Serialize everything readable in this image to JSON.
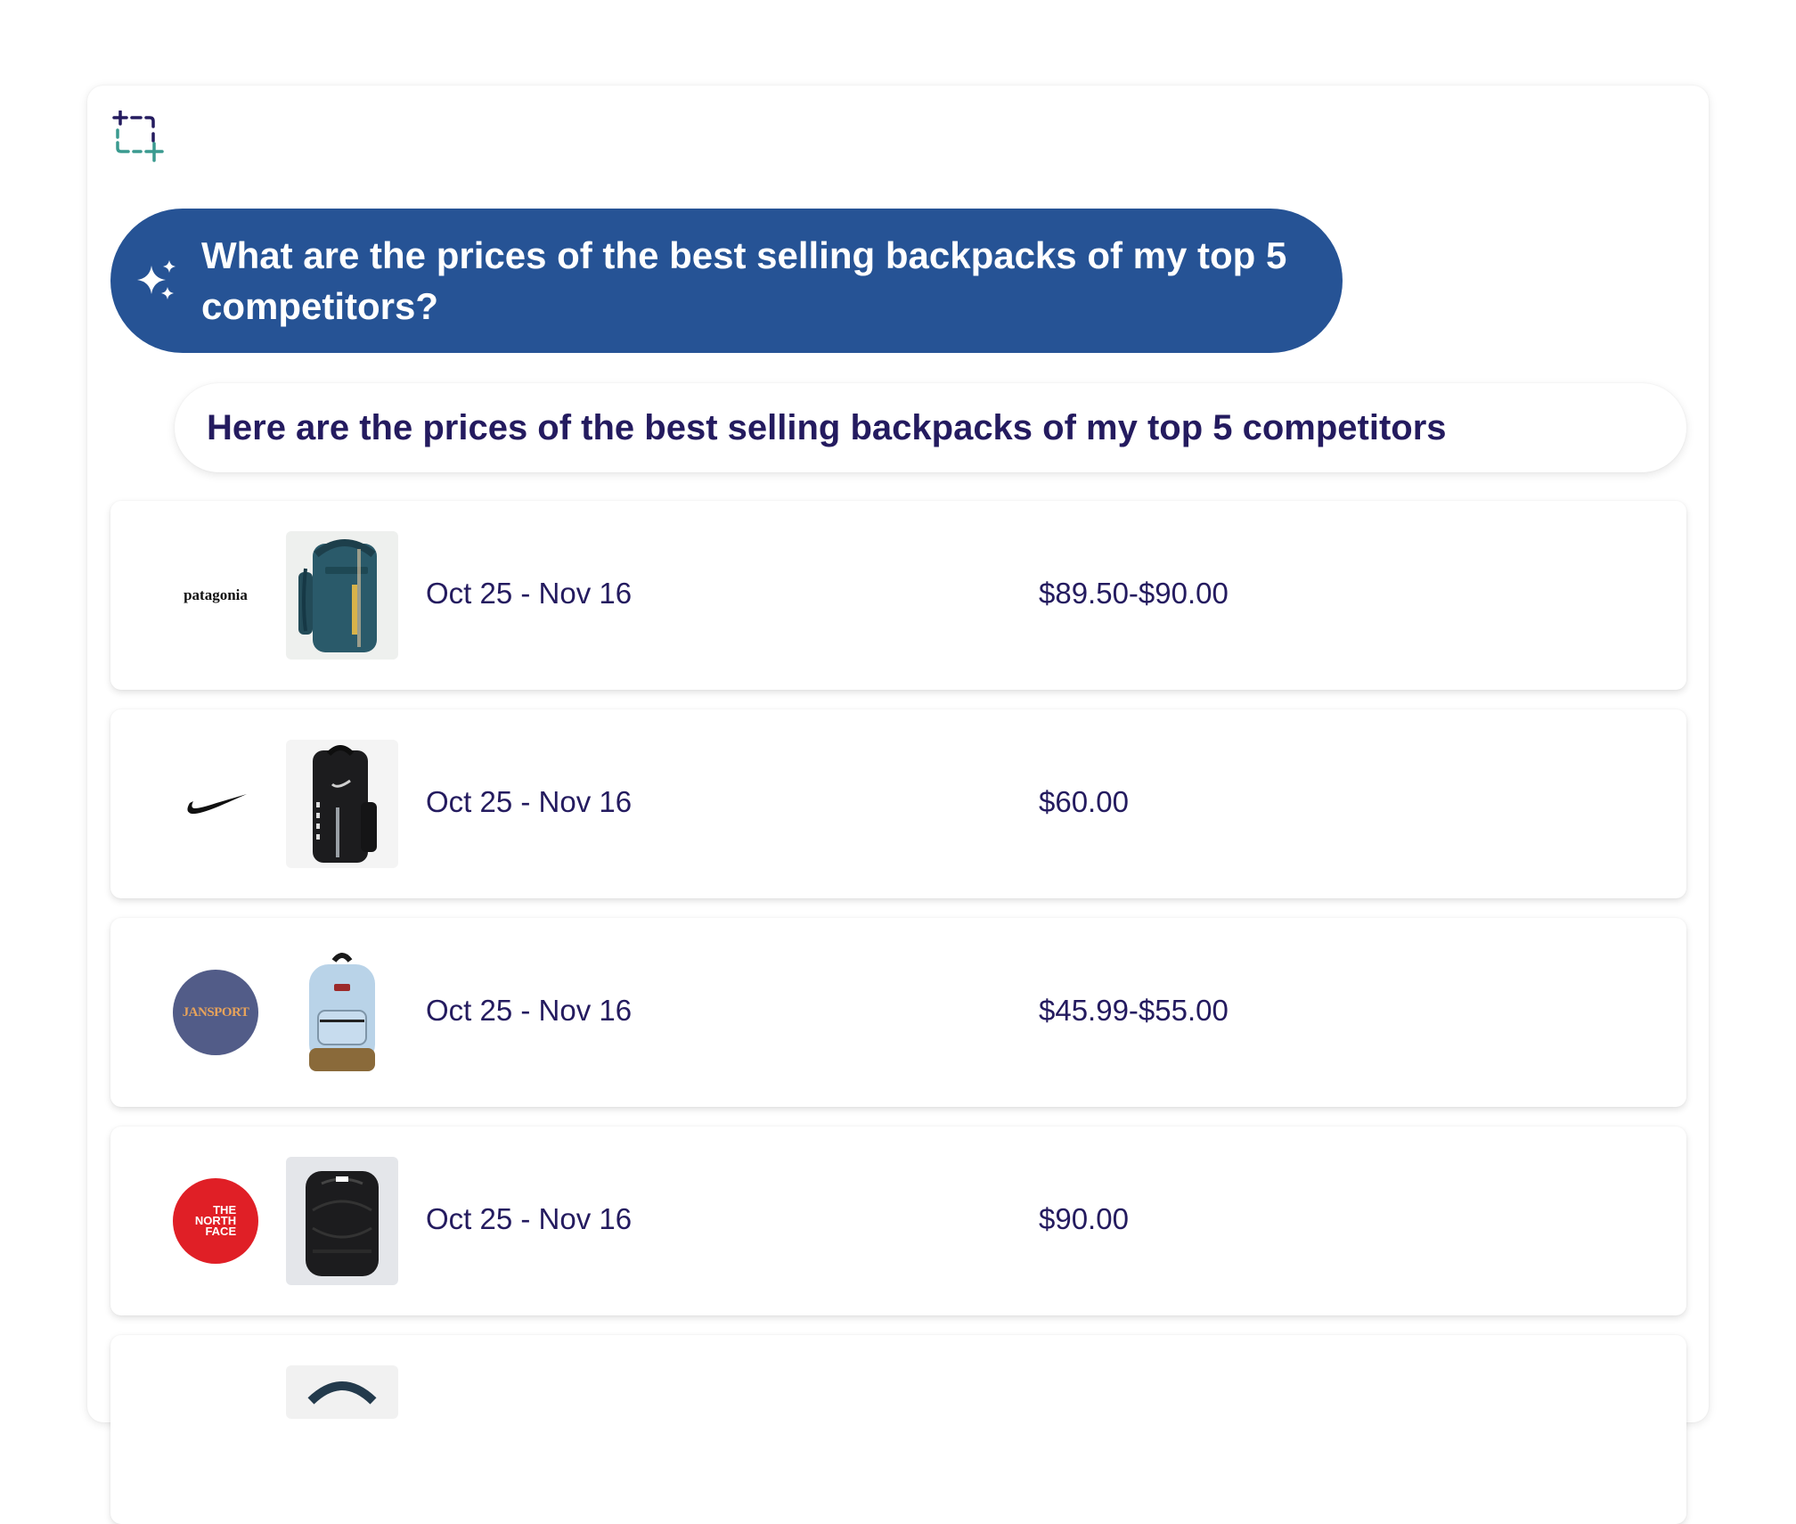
{
  "question": {
    "text": "What are the prices of the best selling backpacks of my top 5 competitors?"
  },
  "answer": {
    "text": "Here are  the prices of the best selling backpacks of my top 5 competitors"
  },
  "rows": [
    {
      "brand": "patagonia",
      "logo_text": "patagonia",
      "date_range": "Oct 25 - Nov 16",
      "price": "$89.50-$90.00",
      "bag_color": "#2a5a6a"
    },
    {
      "brand": "nike",
      "logo_text": "",
      "date_range": "Oct 25 - Nov 16",
      "price": "$60.00",
      "bag_color": "#1c1c1e"
    },
    {
      "brand": "jansport",
      "logo_text": "JANSPORT",
      "date_range": "Oct 25 - Nov 16",
      "price": "$45.99-$55.00",
      "bag_color": "#b9d3e8"
    },
    {
      "brand": "the-north-face",
      "logo_text": "THE NORTH FACE",
      "date_range": "Oct 25 - Nov 16",
      "price": "$90.00",
      "bag_color": "#1c1c1e"
    }
  ],
  "colors": {
    "question_bg": "#265395",
    "text_primary": "#241b5f",
    "accent_teal": "#3a9a8f",
    "jansport_bg": "#525c88",
    "tnf_red": "#e01f26"
  },
  "icons": {
    "crop": "crop-select-icon",
    "sparkle": "sparkle-icon"
  }
}
